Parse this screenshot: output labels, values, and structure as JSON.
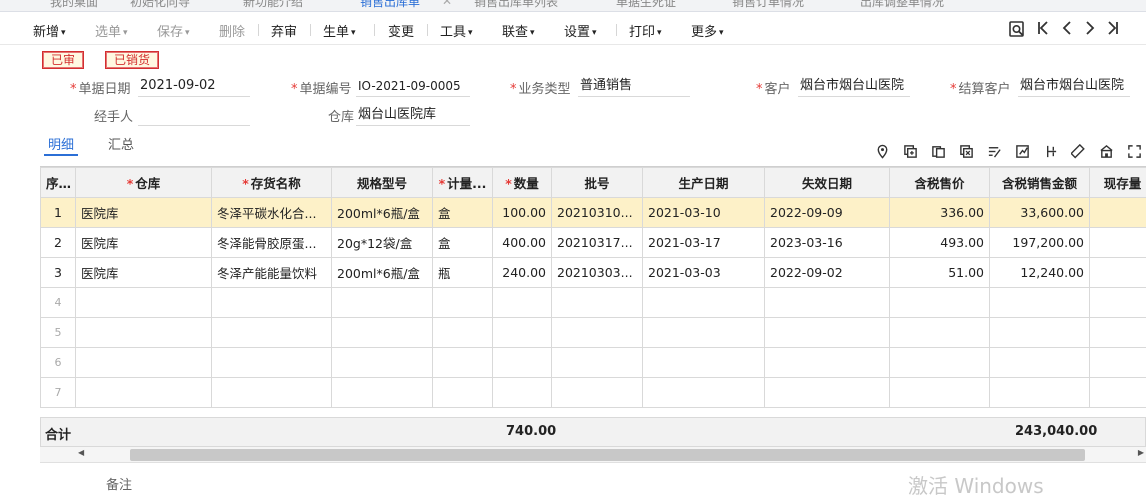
{
  "tabs": [
    "我的桌面",
    "初始化向导",
    "新功能介绍",
    "销售出库单",
    "销售出库单列表",
    "单据生死证",
    "销售订单情况",
    "出库调整单情况"
  ],
  "toolbar": {
    "items": [
      {
        "label": "新增",
        "caret": true,
        "enabled": true
      },
      {
        "label": "选单",
        "caret": true,
        "enabled": false
      },
      {
        "label": "保存",
        "caret": true,
        "enabled": false
      },
      {
        "label": "删除",
        "caret": false,
        "enabled": false
      },
      {
        "label": "弃审",
        "caret": false,
        "enabled": true
      },
      {
        "label": "生单",
        "caret": true,
        "enabled": true
      },
      {
        "label": "变更",
        "caret": false,
        "enabled": true
      },
      {
        "label": "工具",
        "caret": true,
        "enabled": true
      },
      {
        "label": "联查",
        "caret": true,
        "enabled": true
      },
      {
        "label": "设置",
        "caret": true,
        "enabled": true
      },
      {
        "label": "打印",
        "caret": true,
        "enabled": true
      },
      {
        "label": "更多",
        "caret": true,
        "enabled": true
      }
    ],
    "nav_icons": [
      "search-doc-icon",
      "first-icon",
      "prev-icon",
      "next-icon",
      "last-icon"
    ]
  },
  "badges": [
    "已审",
    "已销货"
  ],
  "form": {
    "date_label": "单据日期",
    "date_value": "2021-09-02",
    "code_label": "单据编号",
    "code_value": "IO-2021-09-0005",
    "type_label": "业务类型",
    "type_value": "普通销售",
    "customer_label": "客户",
    "customer_value": "烟台市烟台山医院",
    "settle_label": "结算客户",
    "settle_value": "烟台市烟台山医院",
    "handler_label": "经手人",
    "handler_value": "",
    "warehouse_label": "仓库",
    "warehouse_value": "烟台山医院库"
  },
  "subtabs": [
    "明细",
    "汇总"
  ],
  "table": {
    "headers": [
      "序号",
      "仓库",
      "存货名称",
      "规格型号",
      "计量...",
      "数量",
      "批号",
      "生产日期",
      "失效日期",
      "含税售价",
      "含税销售金额",
      "现存量"
    ],
    "rows": [
      [
        "1",
        "医院库",
        "冬泽平碳水化合...",
        "200ml*6瓶/盒",
        "盒",
        "100.00",
        "20210310...",
        "2021-03-10",
        "2022-09-09",
        "336.00",
        "33,600.00",
        ""
      ],
      [
        "2",
        "医院库",
        "冬泽能骨胶原蛋...",
        "20g*12袋/盒",
        "盒",
        "400.00",
        "20210317...",
        "2021-03-17",
        "2023-03-16",
        "493.00",
        "197,200.00",
        ""
      ],
      [
        "3",
        "医院库",
        "冬泽产能能量饮料",
        "200ml*6瓶/盒",
        "瓶",
        "240.00",
        "20210303...",
        "2021-03-03",
        "2022-09-02",
        "51.00",
        "12,240.00",
        ""
      ],
      [
        "4",
        "",
        "",
        "",
        "",
        "",
        "",
        "",
        "",
        "",
        "",
        ""
      ],
      [
        "5",
        "",
        "",
        "",
        "",
        "",
        "",
        "",
        "",
        "",
        "",
        ""
      ],
      [
        "6",
        "",
        "",
        "",
        "",
        "",
        "",
        "",
        "",
        "",
        "",
        ""
      ],
      [
        "7",
        "",
        "",
        "",
        "",
        "",
        "",
        "",
        "",
        "",
        "",
        ""
      ]
    ],
    "footer_label": "合计",
    "footer_qty": "740.00",
    "footer_amount": "243,040.00"
  },
  "remark_label": "备注",
  "watermark": "激活 Windows"
}
